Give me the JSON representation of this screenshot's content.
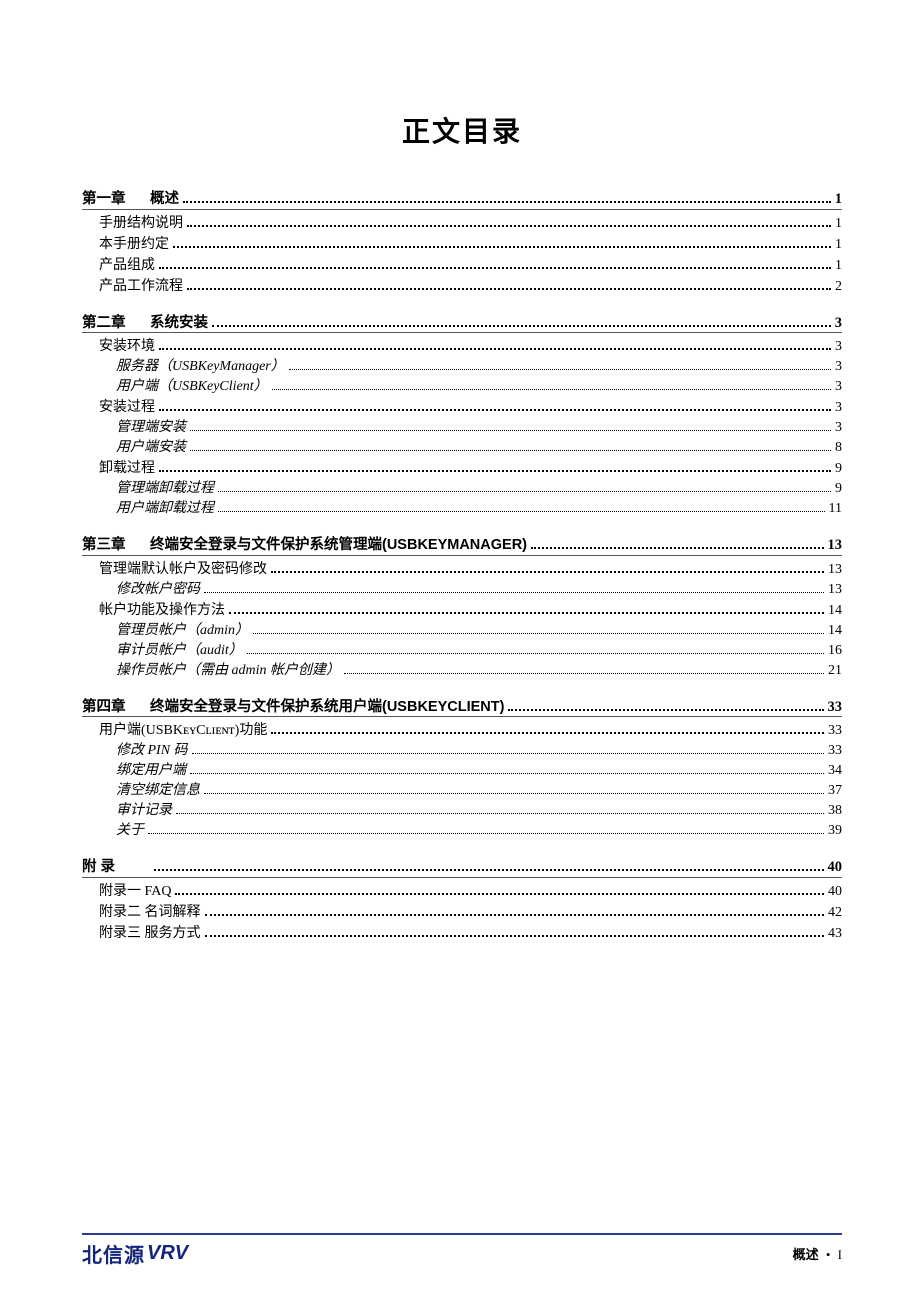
{
  "title": "正文目录",
  "footer": {
    "brand_zh": "北信源",
    "brand_lat": "VRV",
    "section_label": "概述",
    "page_marker": "I"
  },
  "groups": [
    {
      "head": {
        "chapter": "第一章",
        "title": "概述",
        "page": "1"
      },
      "items": [
        {
          "lvl": 1,
          "t": "手册结构说明",
          "p": "1"
        },
        {
          "lvl": 1,
          "t": "本手册约定",
          "p": "1"
        },
        {
          "lvl": 1,
          "t": "产品组成",
          "p": "1"
        },
        {
          "lvl": 1,
          "t": "产品工作流程",
          "p": "2"
        }
      ]
    },
    {
      "head": {
        "chapter": "第二章",
        "title": "系统安装",
        "page": "3"
      },
      "items": [
        {
          "lvl": 1,
          "t": "安装环境",
          "p": "3"
        },
        {
          "lvl": 2,
          "t": "服务器（USBKeyManager）",
          "p": "3"
        },
        {
          "lvl": 2,
          "t": "用户端（USBKeyClient）",
          "p": "3"
        },
        {
          "lvl": 1,
          "t": "安装过程",
          "p": "3"
        },
        {
          "lvl": 2,
          "t": "管理端安装",
          "p": "3"
        },
        {
          "lvl": 2,
          "t": "用户端安装",
          "p": "8"
        },
        {
          "lvl": 1,
          "t": "卸载过程",
          "p": "9"
        },
        {
          "lvl": 2,
          "t": "管理端卸载过程",
          "p": "9"
        },
        {
          "lvl": 2,
          "t": "用户端卸载过程",
          "p": "11"
        }
      ]
    },
    {
      "head": {
        "chapter": "第三章",
        "title": "终端安全登录与文件保护系统管理端(USBKEYMANAGER)",
        "page": "13"
      },
      "items": [
        {
          "lvl": 1,
          "t": "管理端默认帐户及密码修改",
          "p": "13"
        },
        {
          "lvl": 2,
          "t": "修改帐户密码",
          "p": "13"
        },
        {
          "lvl": 1,
          "t": "帐户功能及操作方法",
          "p": "14"
        },
        {
          "lvl": 2,
          "t": "管理员帐户（admin）",
          "p": "14"
        },
        {
          "lvl": 2,
          "t": "审计员帐户（audit）",
          "p": "16"
        },
        {
          "lvl": 2,
          "t": "操作员帐户（需由 admin 帐户创建）",
          "p": "21"
        }
      ]
    },
    {
      "head": {
        "chapter": "第四章",
        "title": "终端安全登录与文件保护系统用户端(USBKEYCLIENT)",
        "page": "33"
      },
      "items": [
        {
          "lvl": 1,
          "t": "用户端(USBKᴇʏCʟɪᴇɴᴛ)功能",
          "p": "33"
        },
        {
          "lvl": 2,
          "t": "修改 PIN 码",
          "p": "33"
        },
        {
          "lvl": 2,
          "t": "绑定用户端",
          "p": "34"
        },
        {
          "lvl": 2,
          "t": "清空绑定信息",
          "p": "37"
        },
        {
          "lvl": 2,
          "t": "审计记录",
          "p": "38"
        },
        {
          "lvl": 2,
          "t": "关于",
          "p": "39"
        }
      ]
    },
    {
      "head": {
        "chapter": "附 录",
        "title": "",
        "page": "40"
      },
      "items": [
        {
          "lvl": 1,
          "t": "附录一 FAQ",
          "p": "40"
        },
        {
          "lvl": 1,
          "t": "附录二 名词解释",
          "p": "42"
        },
        {
          "lvl": 1,
          "t": "附录三 服务方式",
          "p": "43"
        }
      ]
    }
  ]
}
